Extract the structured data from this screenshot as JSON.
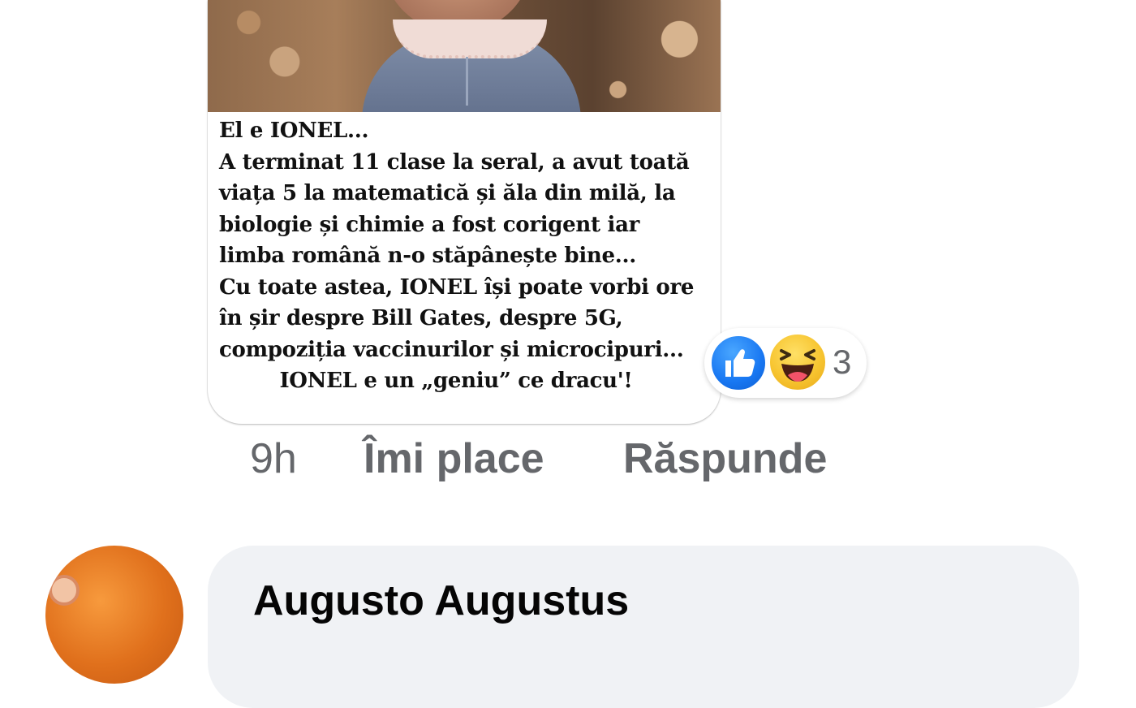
{
  "post_image": {
    "caption_lines": [
      "El e IONEL...",
      "A terminat 11 clase la seral, a avut toată",
      "viața 5 la matematică și ăla din milă, la",
      "biologie și chimie a fost corigent iar",
      "limba română n-o stăpânește bine...",
      "Cu toate astea, IONEL își poate vorbi ore",
      "în șir despre Bill Gates,  despre 5G,",
      "compoziția vaccinurilor și microcipuri...",
      "IONEL e un „geniu” ce dracu'!"
    ]
  },
  "reactions": {
    "icons": [
      "like-icon",
      "haha-icon"
    ],
    "count": "3",
    "colors": {
      "like": "#1877f2",
      "haha": "#f7c531"
    }
  },
  "comment_actions": {
    "time": "9h",
    "like_label": "Îmi place",
    "reply_label": "Răspunde"
  },
  "next_comment": {
    "author": "Augusto Augustus"
  }
}
